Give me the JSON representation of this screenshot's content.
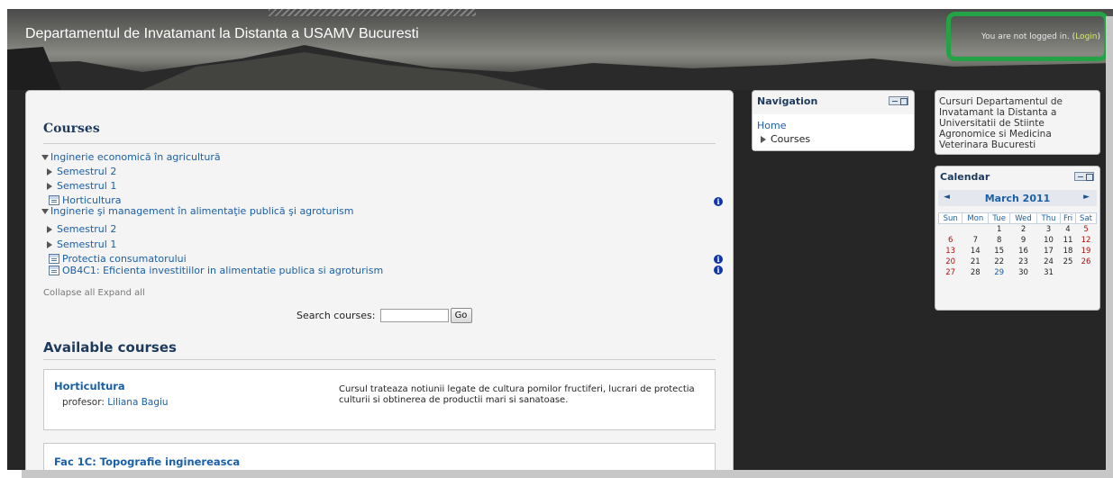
{
  "header": {
    "site_title": "Departamentul de Invatamant la Distanta a USAMV Bucuresti",
    "login_prefix": "You are not logged in. (",
    "login_link": "Login",
    "login_suffix": ")"
  },
  "main": {
    "courses_heading": "Courses",
    "tree": [
      {
        "type": "category-open",
        "label": "Inginerie economică în agricultură"
      },
      {
        "type": "category-closed",
        "label": "Semestrul 2"
      },
      {
        "type": "category-closed",
        "label": "Semestrul 1"
      },
      {
        "type": "course",
        "label": "Horticultura",
        "info": true
      },
      {
        "type": "category-open",
        "label": "Inginerie şi management în alimentaţie publică şi agroturism"
      },
      {
        "type": "category-closed",
        "label": "Semestrul 2"
      },
      {
        "type": "category-closed",
        "label": "Semestrul 1"
      },
      {
        "type": "course",
        "label": "Protectia consumatorului",
        "info": true
      },
      {
        "type": "course",
        "label": "OB4C1: Eficienta investitiilor in alimentatie publica si agroturism",
        "info": true
      }
    ],
    "collapse_all": "Collapse all",
    "expand_all": "Expand all",
    "search_label": "Search courses:",
    "search_value": "",
    "go_label": "Go",
    "available_heading": "Available courses",
    "available_courses": [
      {
        "name": "Horticultura",
        "teacher_label": "profesor:",
        "teacher_name": "Liliana Bagiu",
        "summary": "Cursul trateaza notiunii legate de cultura pomilor fructiferi, lucrari de protectia culturii si obtinerea de productii mari si sanatoase."
      },
      {
        "name": "Fac 1C: Topografie inginereasca",
        "teacher_label": "",
        "teacher_name": "",
        "summary": ""
      }
    ]
  },
  "navigation": {
    "title": "Navigation",
    "home": "Home",
    "courses": "Courses"
  },
  "description_block": {
    "text": "Cursuri Departamentul de Invatamant la Distanta a Universitatii de Stiinte Agronomice si Medicina Veterinara Bucuresti"
  },
  "calendar": {
    "title": "Calendar",
    "prev_icon": "◄",
    "next_icon": "►",
    "month": "March 2011",
    "weekdays": [
      "Sun",
      "Mon",
      "Tue",
      "Wed",
      "Thu",
      "Fri",
      "Sat"
    ],
    "weeks": [
      [
        "",
        "",
        "1",
        "2",
        "3",
        "4",
        "5"
      ],
      [
        "6",
        "7",
        "8",
        "9",
        "10",
        "11",
        "12"
      ],
      [
        "13",
        "14",
        "15",
        "16",
        "17",
        "18",
        "19"
      ],
      [
        "20",
        "21",
        "22",
        "23",
        "24",
        "25",
        "26"
      ],
      [
        "27",
        "28",
        "29",
        "30",
        "31",
        "",
        ""
      ]
    ],
    "today": "29"
  },
  "colors": {
    "link": "#1a5fa8",
    "heading": "#1d3a5c",
    "highlight": "#25a245",
    "weekend": "#b01010"
  }
}
